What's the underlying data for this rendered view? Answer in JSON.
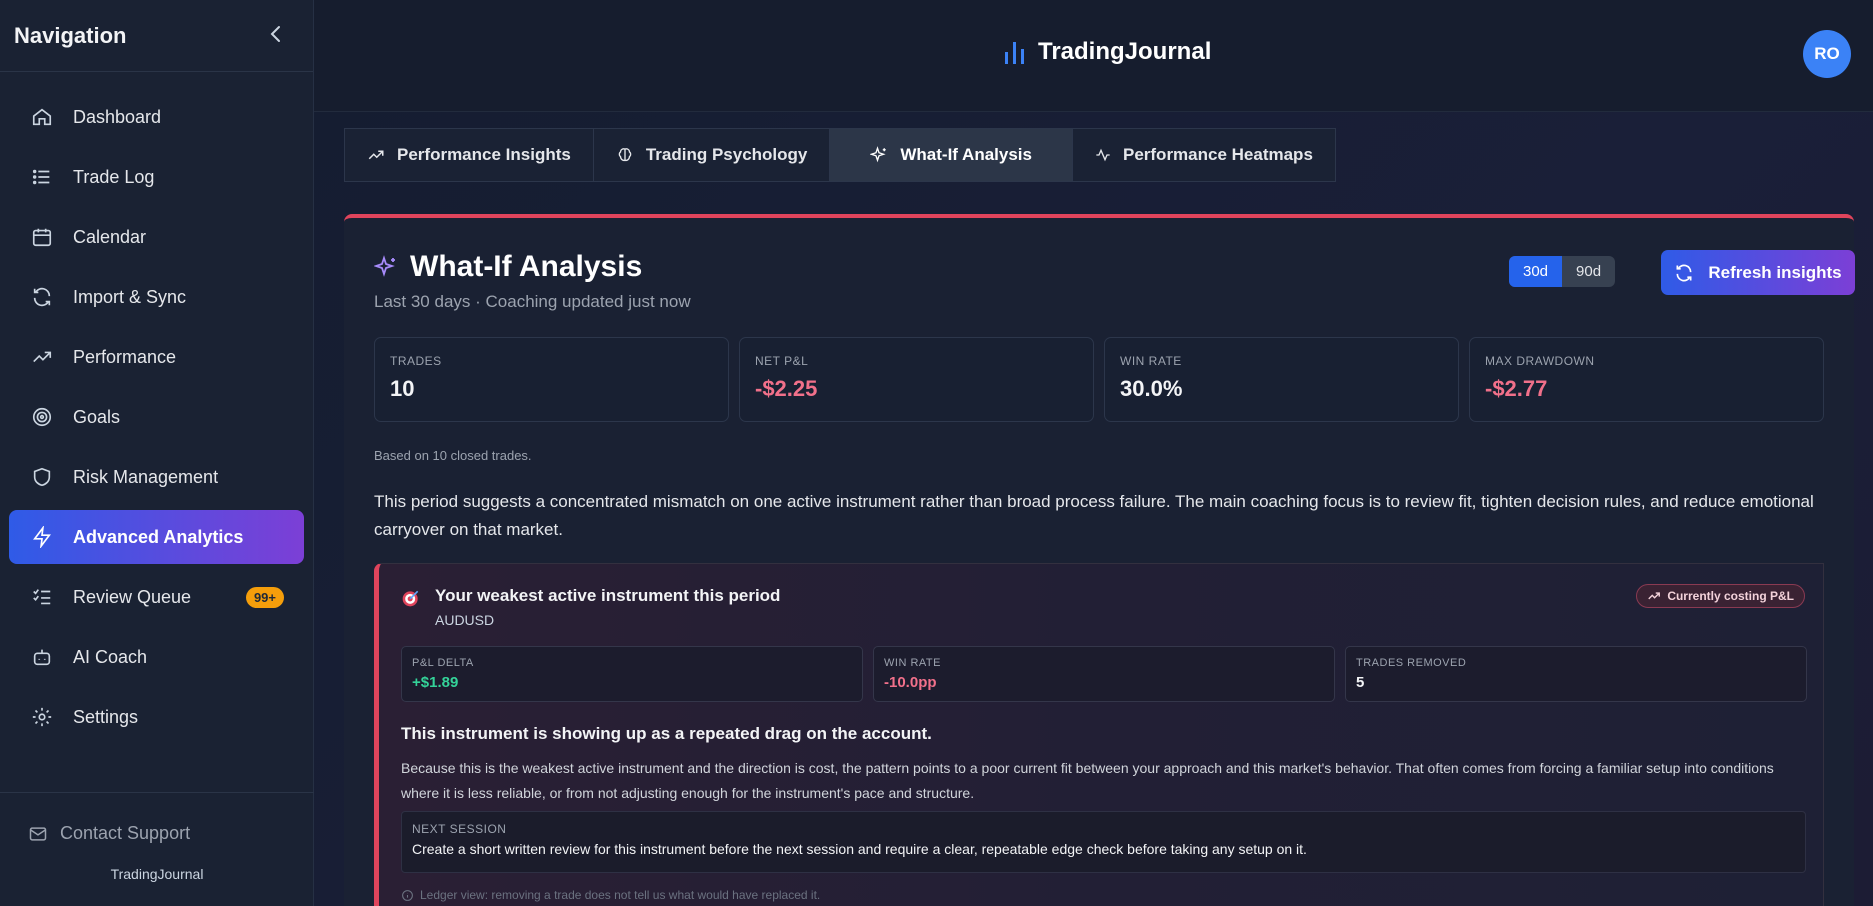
{
  "sidebar": {
    "title": "Navigation",
    "collapse_icon": "chevron-left-icon",
    "items": [
      {
        "label": "Dashboard",
        "icon": "home-icon"
      },
      {
        "label": "Trade Log",
        "icon": "list-icon"
      },
      {
        "label": "Calendar",
        "icon": "calendar-icon"
      },
      {
        "label": "Import & Sync",
        "icon": "refresh-icon"
      },
      {
        "label": "Performance",
        "icon": "trending-up-icon"
      },
      {
        "label": "Goals",
        "icon": "target-icon"
      },
      {
        "label": "Risk Management",
        "icon": "shield-icon"
      },
      {
        "label": "Advanced Analytics",
        "icon": "bolt-icon",
        "active": true
      },
      {
        "label": "Review Queue",
        "icon": "checklist-icon",
        "badge": "99+"
      },
      {
        "label": "AI Coach",
        "icon": "bot-icon"
      },
      {
        "label": "Settings",
        "icon": "gear-icon"
      }
    ],
    "support": "Contact Support",
    "brand": "TradingJournal"
  },
  "header": {
    "logo_text": "TradingJournal",
    "avatar": "RO"
  },
  "tabs": [
    {
      "label": "Performance Insights",
      "icon": "trending-up-icon"
    },
    {
      "label": "Trading Psychology",
      "icon": "brain-icon"
    },
    {
      "label": "What-If Analysis",
      "icon": "sparkles-icon",
      "active": true
    },
    {
      "label": "Performance Heatmaps",
      "icon": "activity-icon"
    }
  ],
  "card": {
    "title": "What-If Analysis",
    "subtitle": "Last 30 days · Coaching updated just now",
    "range": {
      "options": [
        "30d",
        "90d"
      ],
      "selected": "30d"
    },
    "refresh_label": "Refresh insights",
    "stats": [
      {
        "label": "TRADES",
        "value": "10"
      },
      {
        "label": "NET P&L",
        "value": "-$2.25",
        "negative": true
      },
      {
        "label": "WIN RATE",
        "value": "30.0%"
      },
      {
        "label": "MAX DRAWDOWN",
        "value": "-$2.77",
        "negative": true
      }
    ],
    "based_on": "Based on 10 closed trades.",
    "summary": "This period suggests a concentrated mismatch on one active instrument rather than broad process failure. The main coaching focus is to review fit, tighten decision rules, and reduce emotional carryover on that market."
  },
  "insight": {
    "title": "Your weakest active instrument this period",
    "instrument": "AUDUSD",
    "tag": "Currently costing P&L",
    "metrics": [
      {
        "label": "P&L DELTA",
        "value": "+$1.89",
        "tone": "pos"
      },
      {
        "label": "WIN RATE",
        "value": "-10.0pp",
        "tone": "neg"
      },
      {
        "label": "TRADES REMOVED",
        "value": "5",
        "tone": ""
      }
    ],
    "headline": "This instrument is showing up as a repeated drag on the account.",
    "body": "Because this is the weakest active instrument and the direction is cost, the pattern points to a poor current fit between your approach and this market's behavior. That often comes from forcing a familiar setup into conditions where it is less reliable, or from not adjusting enough for the instrument's pace and structure.",
    "next_label": "NEXT SESSION",
    "next_text": "Create a short written review for this instrument before the next session and require a clear, repeatable edge check before taking any setup on it.",
    "ledger": "Ledger view: removing a trade does not tell us what would have replaced it."
  },
  "colors": {
    "accent_start": "#2f5be7",
    "accent_end": "#7c3fd6",
    "negative": "#f1708a",
    "positive": "#34d399",
    "alert": "#e0445c",
    "badge": "#f59e0b"
  }
}
